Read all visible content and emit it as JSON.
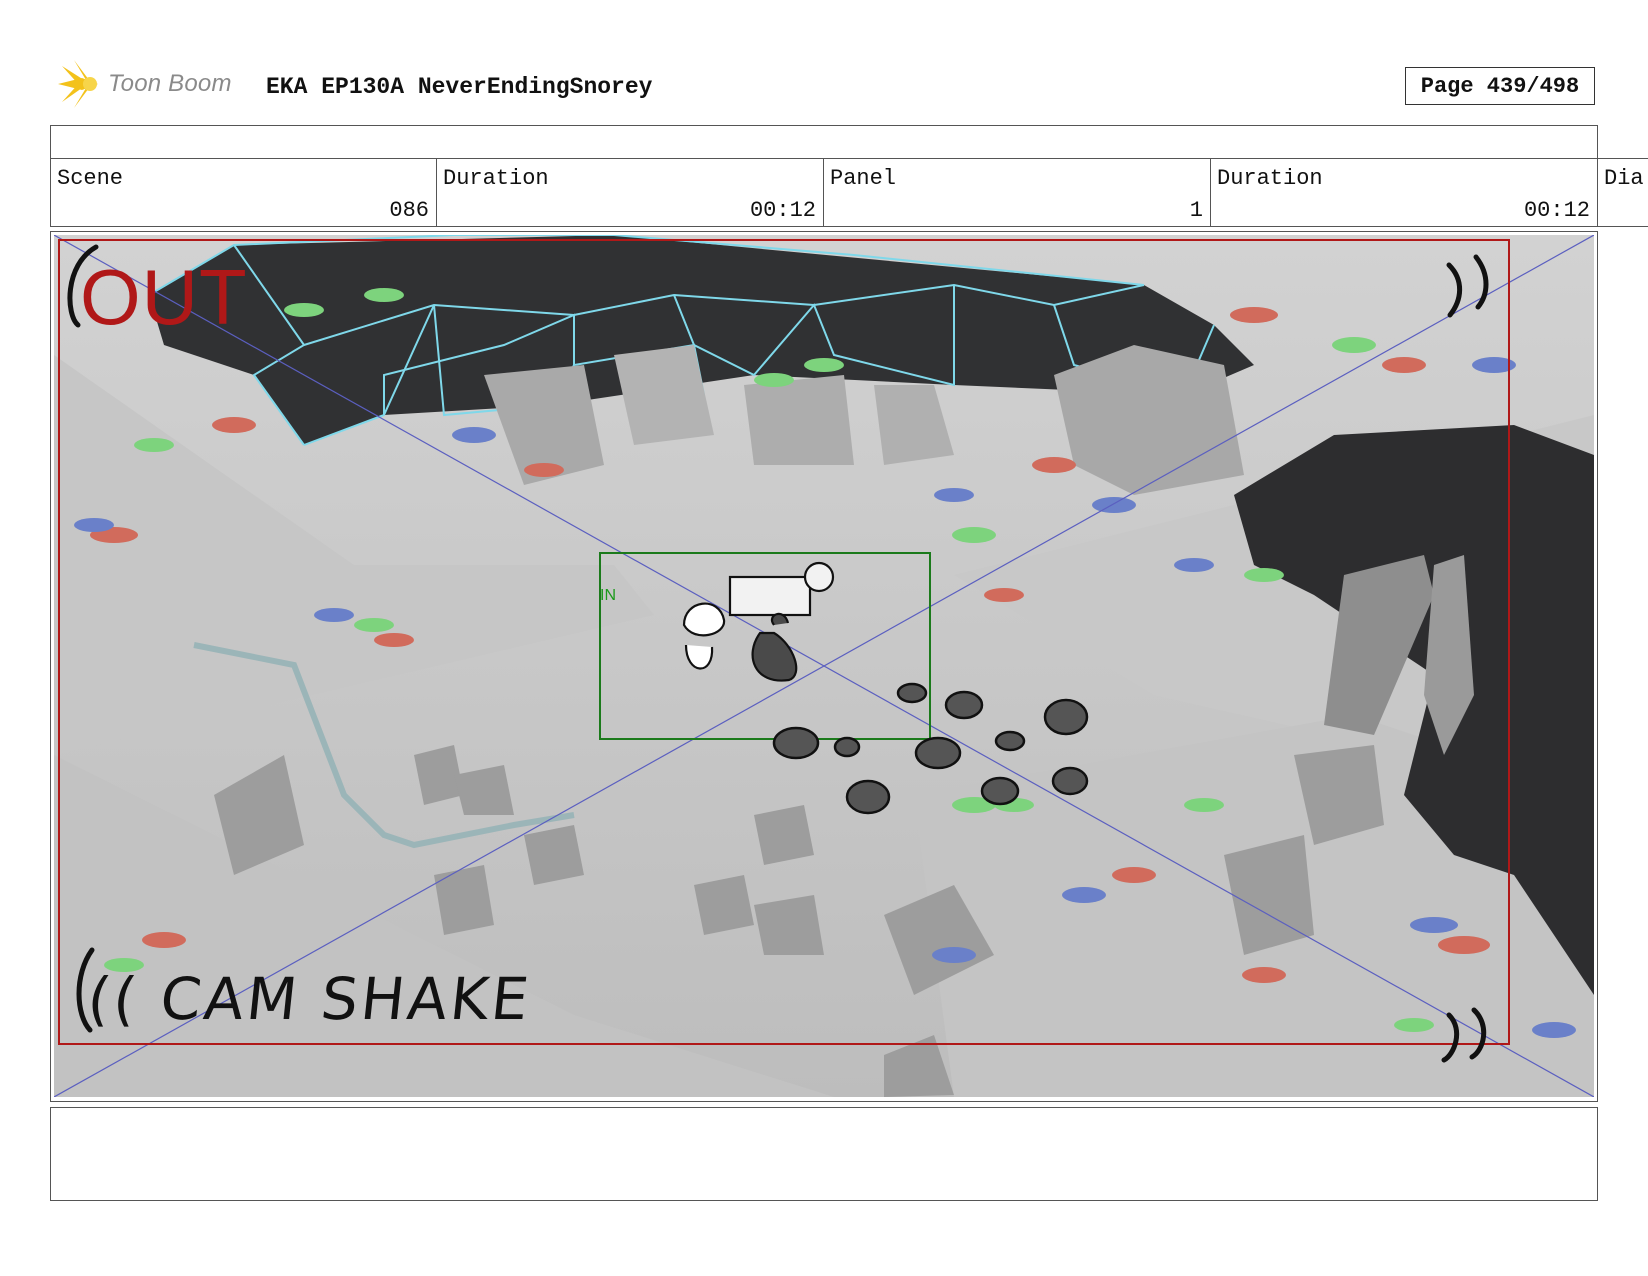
{
  "header": {
    "logo_text": "Toon Boom",
    "doc_title": "EKA EP130A NeverEndingSnorey",
    "page": "Page 439/498"
  },
  "info": {
    "scene_label": "Scene",
    "scene_value": "086",
    "scene_duration_label": "Duration",
    "scene_duration_value": "00:12",
    "panel_label": "Panel",
    "panel_value": "1",
    "panel_duration_label": "Duration",
    "panel_duration_value": "00:12",
    "dialogue_label": "Dia"
  },
  "panel": {
    "out_label": "OUT",
    "in_label": "IN",
    "annotation": "(( CAM SHAKE"
  },
  "colors": {
    "out_frame": "#b01818",
    "in_frame": "#1b7a1b",
    "wireframe": "#7fd8ea",
    "camera_guides": "#5b5fc0"
  }
}
